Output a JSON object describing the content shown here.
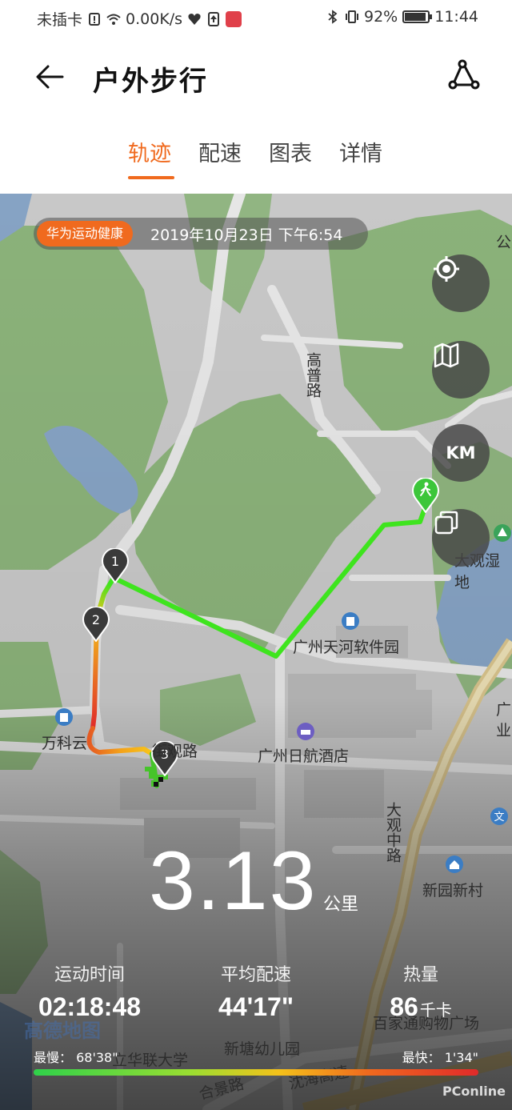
{
  "status_bar": {
    "carrier": "未插卡",
    "speed": "0.00K/s",
    "battery": "92%",
    "battery_level": 0.92,
    "time": "11:44"
  },
  "header": {
    "title": "户外步行",
    "back_icon": "arrow-left-icon",
    "share_icon": "route-share-icon"
  },
  "tabs": [
    {
      "label": "轨迹",
      "active": true
    },
    {
      "label": "配速",
      "active": false
    },
    {
      "label": "图表",
      "active": false
    },
    {
      "label": "详情",
      "active": false
    }
  ],
  "map": {
    "brand": "华为运动健康",
    "datetime": "2019年10月23日 下午6:54",
    "buttons": {
      "locate_icon": "locate-icon",
      "map_style_icon": "map-icon",
      "km_label": "KM",
      "layers_icon": "layers-icon"
    },
    "markers": [
      "1",
      "2",
      "3"
    ],
    "labels": {
      "road_gaopu": "高普路",
      "tianhe_park": "广州天河软件园",
      "rihang_hotel": "广州日航酒店",
      "wanke": "万科云",
      "jieguan_road": "街观路",
      "daguan_road": "大观中路",
      "xinhui_village": "新园新村",
      "daguan_wetland": "大观湿地",
      "xintang_kindergarten": "新塘幼儿园",
      "hualian_university": "立华联大学",
      "baijiatong": "百家通购物广场",
      "hejing_road": "合景路",
      "shenhai": "沈海高速",
      "guang_cut": "广",
      "ye_cut": "业",
      "gong_cut": "公"
    }
  },
  "summary": {
    "distance": "3.13",
    "distance_unit": "公里",
    "stats": [
      {
        "label": "运动时间",
        "value": "02:18:48",
        "unit": ""
      },
      {
        "label": "平均配速",
        "value": "44'17\"",
        "unit": ""
      },
      {
        "label": "热量",
        "value": "86",
        "unit": "千卡"
      }
    ],
    "slowest": "最慢： 68'38\"",
    "fastest": "最快： 1'34\"",
    "amap_watermark": "高德地图",
    "pc_watermark": "PConline"
  },
  "colors": {
    "accent": "#f06a1e",
    "track_fast": "#39e51e",
    "track_slow": "#e02a2a"
  }
}
